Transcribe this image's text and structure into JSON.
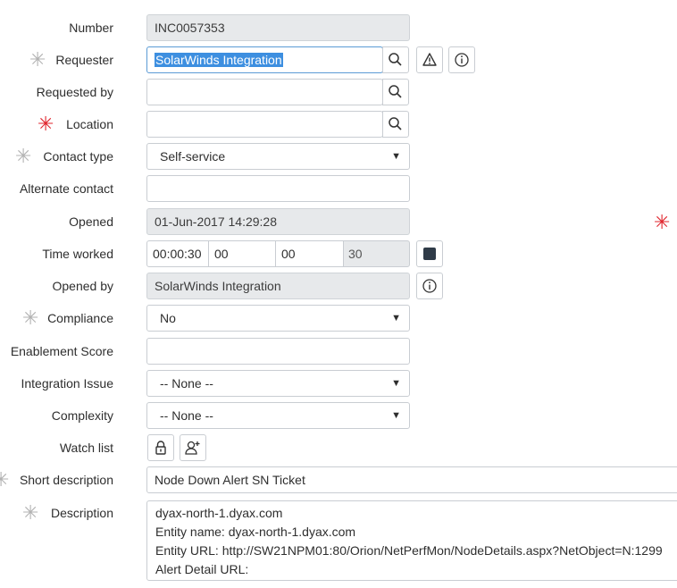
{
  "fields": {
    "number": {
      "label": "Number",
      "value": "INC0057353"
    },
    "requester": {
      "label": "Requester",
      "value": "SolarWinds Integration"
    },
    "requested_by": {
      "label": "Requested by",
      "value": ""
    },
    "location": {
      "label": "Location",
      "value": ""
    },
    "contact_type": {
      "label": "Contact type",
      "value": "Self-service"
    },
    "alternate_contact": {
      "label": "Alternate contact",
      "value": ""
    },
    "opened": {
      "label": "Opened",
      "value": "01-Jun-2017 14:29:28"
    },
    "time_worked": {
      "label": "Time worked",
      "total": "00:00:30",
      "hours": "00",
      "minutes": "00",
      "seconds": "30"
    },
    "opened_by": {
      "label": "Opened by",
      "value": "SolarWinds Integration"
    },
    "compliance": {
      "label": "Compliance",
      "value": "No"
    },
    "enablement_score": {
      "label": "Enablement Score",
      "value": ""
    },
    "integration_issue": {
      "label": "Integration Issue",
      "value": "-- None --"
    },
    "complexity": {
      "label": "Complexity",
      "value": "-- None --"
    },
    "watch_list": {
      "label": "Watch list"
    },
    "short_description": {
      "label": "Short description",
      "value": "Node Down Alert SN Ticket"
    },
    "description": {
      "label": "Description",
      "lines": [
        "dyax-north-1.dyax.com",
        "Entity name: dyax-north-1.dyax.com",
        "Entity URL: http://SW21NPM01:80/Orion/NetPerfMon/NodeDetails.aspx?NetObject=N:1299",
        "Alert Detail URL:"
      ]
    }
  },
  "glyphs": {
    "mandatory": "✳",
    "caret": "▼"
  },
  "colors": {
    "mandatory_grey": "#b2b2b2",
    "mandatory_red": "#e0242c",
    "selection": "#3d8fe0",
    "readonly_bg": "#e7e9eb"
  }
}
